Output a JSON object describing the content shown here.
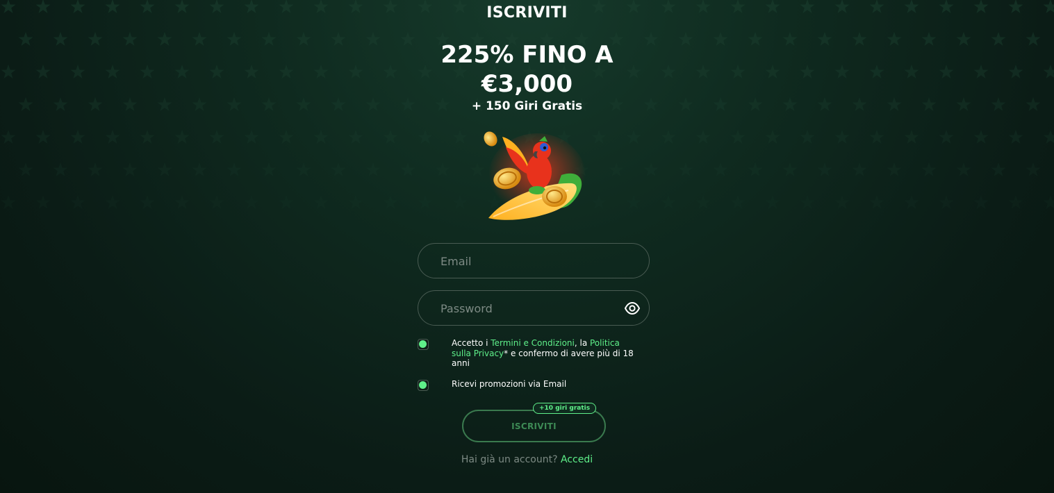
{
  "page": {
    "title": "ISCRIVITI",
    "headline_line1": "225% FINO A",
    "headline_line2": "€3,000",
    "subline": "+ 150 Giri Gratis"
  },
  "hero": {
    "icon": "parrot-surfboard-coins-illustration"
  },
  "form": {
    "email_placeholder": "Email",
    "password_placeholder": "Password",
    "password_toggle_icon": "eye-icon",
    "terms": {
      "prefix": "Accetto i ",
      "terms_link": "Termini e Condizioni",
      "middle": ", la ",
      "privacy_link": "Politica sulla Privacy",
      "suffix": "* e confermo di avere più di 18 anni",
      "checked": true
    },
    "promotions": {
      "label": "Ricevi promozioni via Email",
      "checked": true
    },
    "submit_label": "ISCRIVITI",
    "submit_badge": "+10 giri gratis"
  },
  "footer": {
    "question": "Hai già un account?",
    "login_link": "Accedi"
  },
  "colors": {
    "accent_green": "#5ff08a",
    "background": "#0b1c16",
    "button_border": "#3a7a4e"
  }
}
